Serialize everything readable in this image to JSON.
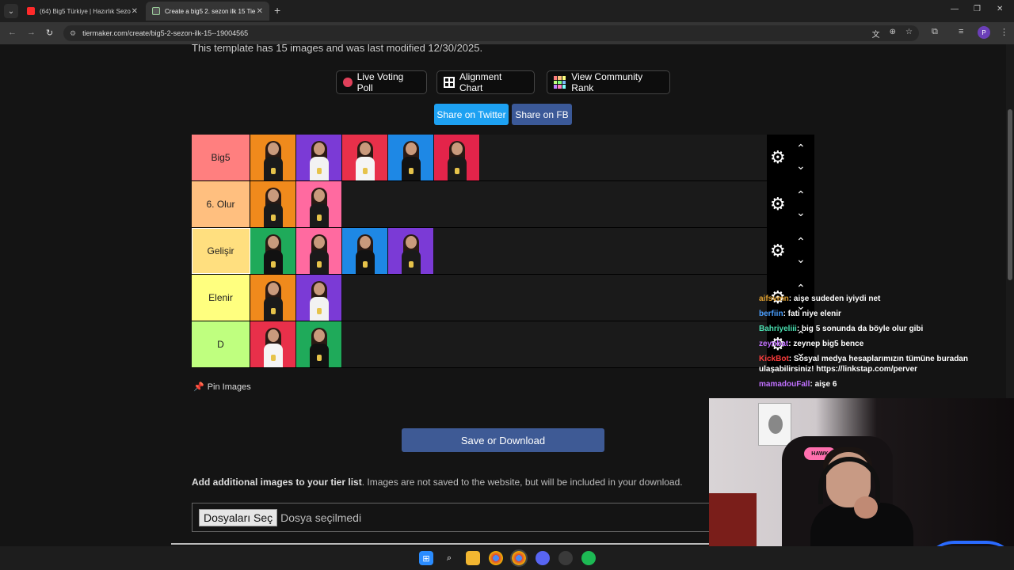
{
  "browser": {
    "tabs": [
      {
        "title": "(64) Big5 Türkiye | Hazırlık Sezo",
        "active": false
      },
      {
        "title": "Create a big5 2. sezon ilk 15 Tie",
        "active": true
      }
    ],
    "url": "tiermaker.com/create/big5-2-sezon-ilk-15--19004565",
    "profile_initial": "P"
  },
  "page": {
    "template_info": "This template has 15 images and was last modified 12/30/2025.",
    "buttons": {
      "live_voting": "Live Voting Poll",
      "alignment_chart": "Alignment Chart",
      "community_rank": "View Community Rank",
      "share_twitter": "Share on Twitter",
      "share_fb": "Share on FB"
    },
    "tiers": [
      {
        "label": "Big5",
        "color": "#ff7f7f",
        "images": [
          "orange",
          "purple",
          "red",
          "blue",
          "red-new"
        ]
      },
      {
        "label": "6. Olur",
        "color": "#ffbf7f",
        "images": [
          "orange",
          "pink"
        ]
      },
      {
        "label": "Gelişir",
        "color": "#ffdf7f",
        "images": [
          "green",
          "pink",
          "blue",
          "purple-new"
        ]
      },
      {
        "label": "Elenir",
        "color": "#ffff7f",
        "images": [
          "orange",
          "purple"
        ]
      },
      {
        "label": "D",
        "color": "#bfff7f",
        "images": [
          "red",
          "green"
        ]
      }
    ],
    "pin_images": "Pin Images",
    "save_download": "Save or Download",
    "add_info_bold": "Add additional images to your tier list",
    "add_info_rest": ". Images are not saved to the website, but will be included in your download.",
    "file_button": "Dosyaları Seç",
    "file_status": "Dosya seçilmedi"
  },
  "chat": [
    {
      "user": "aifsvmn",
      "color": "#e0a030",
      "text": ": aişe sudeden iyiydi net"
    },
    {
      "user": "berfiin",
      "color": "#4a9eff",
      "text": ": fati niye elenir"
    },
    {
      "user": "Bahriyeliii",
      "color": "#4adfb0",
      "text": ": big 5 sonunda da böyle olur gibi"
    },
    {
      "user": "zeynbat",
      "color": "#c070ff",
      "text": ": zeynep big5 bence"
    },
    {
      "user": "KickBot",
      "color": "#ff3c3c",
      "text": ": Sosyal medya hesaplarımızın tümüne buradan ulaşabilirsiniz! https://linkstap.com/perver"
    },
    {
      "user": "mamadouFall",
      "color": "#c070ff",
      "text": ": aişe 6"
    }
  ],
  "webcam": {
    "chair_brand": "HAWK"
  },
  "colors": {
    "twitter": "#1da1f2",
    "facebook": "#3b5998",
    "save": "#3e5a95"
  }
}
